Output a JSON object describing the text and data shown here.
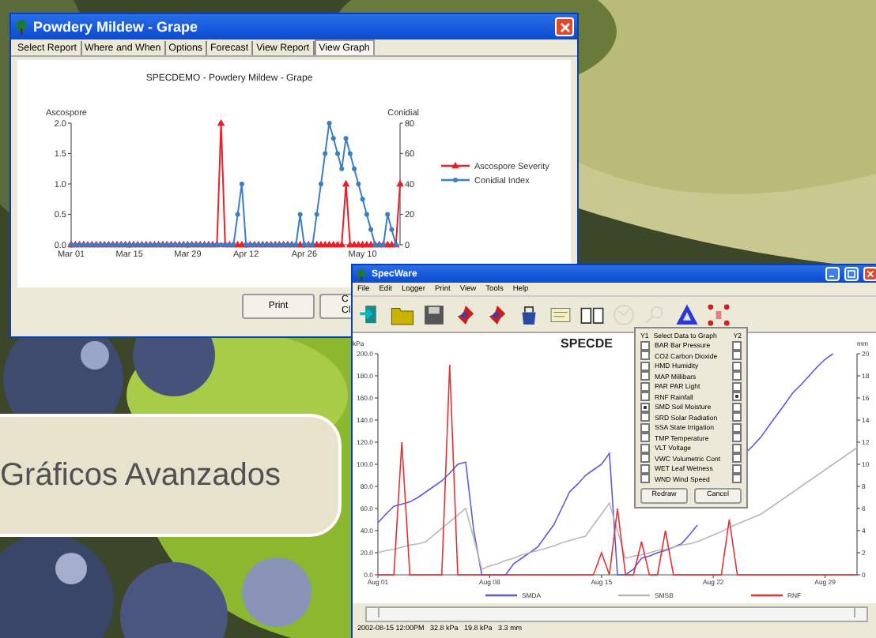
{
  "report_window": {
    "title": "Powdery Mildew - Grape",
    "tabs": [
      {
        "label": "Select Report",
        "selected": false
      },
      {
        "label": "Where and When",
        "selected": false
      },
      {
        "label": "Options",
        "selected": false
      },
      {
        "label": "Forecast",
        "selected": false
      },
      {
        "label": "View Report",
        "selected": false
      },
      {
        "label": "View Graph",
        "selected": true
      }
    ],
    "chart_data": {
      "type": "line",
      "legend": "right",
      "title": "SPECDEMO - Powdery Mildew - Grape",
      "ylabel": "Ascospore",
      "y2label": "Conidial",
      "categories": [
        "Mar 01",
        null,
        null,
        null,
        null,
        null,
        null,
        null,
        null,
        null,
        null,
        null,
        null,
        null,
        "Mar 15",
        null,
        null,
        null,
        null,
        null,
        null,
        null,
        null,
        null,
        null,
        null,
        null,
        null,
        "Mar 29",
        null,
        null,
        null,
        null,
        null,
        null,
        null,
        null,
        null,
        null,
        null,
        null,
        null,
        "Apr 12",
        null,
        null,
        null,
        null,
        null,
        null,
        null,
        null,
        null,
        null,
        null,
        null,
        null,
        "Apr 26",
        null,
        null,
        null,
        null,
        null,
        null,
        null,
        null,
        null,
        null,
        null,
        null,
        null,
        "May 10",
        null,
        null,
        null,
        null,
        null,
        null,
        null,
        null,
        null
      ],
      "ylim": [
        0,
        2
      ],
      "yticks": [
        {
          "value": 0,
          "label": "0.0"
        },
        {
          "value": 0.5,
          "label": "0.5"
        },
        {
          "value": 1,
          "label": "1.0"
        },
        {
          "value": 1.5,
          "label": "1.5"
        },
        {
          "value": 2,
          "label": "2.0"
        }
      ],
      "y2lim": [
        0,
        80
      ],
      "y2ticks": [
        0,
        20,
        40,
        60,
        80
      ],
      "series": [
        {
          "name": "Ascospore Severity",
          "color": "#e8202a",
          "marker": "triangle",
          "values": [
            0,
            0,
            0,
            0,
            0,
            0,
            0,
            0,
            0,
            0,
            0,
            0,
            0,
            0,
            0,
            0,
            0,
            0,
            0,
            0,
            0,
            0,
            0,
            0,
            0,
            0,
            0,
            0,
            0,
            0,
            0,
            0,
            0,
            0,
            0,
            0,
            2,
            0,
            0,
            0,
            0,
            0,
            0,
            0,
            0,
            0,
            0,
            0,
            0,
            0,
            0,
            0,
            0,
            0,
            0,
            0,
            0,
            0,
            0,
            0,
            0,
            0,
            0,
            0,
            0,
            0,
            1,
            0,
            0,
            0,
            0,
            0,
            0,
            0,
            0,
            0,
            0,
            0,
            0,
            1
          ]
        },
        {
          "name": "Conidial Index",
          "color": "#3a7fc4",
          "marker": "circle",
          "axis": "y2",
          "values": [
            0,
            0,
            0,
            0,
            0,
            0,
            0,
            0,
            0,
            0,
            0,
            0,
            0,
            0,
            0,
            0,
            0,
            0,
            0,
            0,
            0,
            0,
            0,
            0,
            0,
            0,
            0,
            0,
            0,
            0,
            0,
            0,
            0,
            0,
            0,
            0,
            0,
            0,
            0,
            0,
            20,
            40,
            0,
            0,
            0,
            0,
            0,
            0,
            0,
            0,
            0,
            0,
            0,
            0,
            0,
            20,
            0,
            0,
            0,
            20,
            40,
            60,
            80,
            70,
            60,
            50,
            70,
            60,
            50,
            40,
            30,
            20,
            10,
            0,
            0,
            0,
            20,
            10,
            0,
            null
          ]
        }
      ]
    },
    "buttons": [
      {
        "lines": [
          "Print"
        ]
      },
      {
        "lines": [
          "C",
          "Cl"
        ]
      }
    ]
  },
  "specware_window": {
    "title": "SpecWare",
    "menu": [
      "File",
      "Edit",
      "Logger",
      "Print",
      "View",
      "Tools",
      "Help"
    ],
    "toolbar": [
      {
        "kind": "door",
        "disabled": false
      },
      {
        "kind": "folder",
        "disabled": false
      },
      {
        "kind": "disk",
        "disabled": false
      },
      {
        "kind": "marker",
        "disabled": false
      },
      {
        "kind": "marker",
        "disabled": false
      },
      {
        "kind": "bucket",
        "disabled": false
      },
      {
        "kind": "note",
        "disabled": false
      },
      {
        "kind": "book",
        "disabled": false
      },
      {
        "kind": "dial",
        "disabled": true
      },
      {
        "kind": "magnifier",
        "disabled": true
      },
      {
        "kind": "triangle",
        "disabled": false
      },
      {
        "kind": "dots",
        "disabled": false
      }
    ],
    "chart_data": {
      "type": "line",
      "legend": "bottom",
      "title": "SPECDE",
      "ylabel": "kPa",
      "y2label": "mm",
      "categories": [
        "Aug 01",
        null,
        null,
        null,
        null,
        null,
        null,
        null,
        null,
        null,
        null,
        null,
        null,
        null,
        "Aug 08",
        null,
        null,
        null,
        null,
        null,
        null,
        null,
        null,
        null,
        null,
        null,
        null,
        null,
        "Aug 15",
        null,
        null,
        null,
        null,
        null,
        null,
        null,
        null,
        null,
        null,
        null,
        null,
        null,
        "Aug 22",
        null,
        null,
        null,
        null,
        null,
        null,
        null,
        null,
        null,
        null,
        null,
        null,
        null,
        "Aug 29",
        null,
        null,
        null,
        null
      ],
      "ylim": [
        0,
        200
      ],
      "yticks": [
        {
          "value": 0,
          "label": "0.0"
        },
        {
          "value": 20,
          "label": "20.0"
        },
        {
          "value": 40,
          "label": "40.0"
        },
        {
          "value": 60,
          "label": "60.0"
        },
        {
          "value": 80,
          "label": "80.0"
        },
        {
          "value": 100,
          "label": "100.0"
        },
        {
          "value": 120,
          "label": "120.0"
        },
        {
          "value": 140,
          "label": "140.0"
        },
        {
          "value": 160,
          "label": "160.0"
        },
        {
          "value": 180,
          "label": "180.0"
        },
        {
          "value": 200,
          "label": "200.0"
        }
      ],
      "y2lim": [
        0,
        20
      ],
      "y2ticks": [
        0,
        2,
        4,
        6,
        8,
        10,
        12,
        14,
        16,
        18,
        20
      ],
      "series": [
        {
          "name": "SMDA",
          "color": "#5a5ae0",
          "values": [
            47,
            55,
            62,
            64,
            66,
            70,
            75,
            80,
            85,
            92,
            100,
            102,
            40,
            0,
            0,
            0,
            0,
            10,
            15,
            20,
            25,
            35,
            45,
            60,
            75,
            82,
            90,
            95,
            100,
            110,
            0,
            0,
            5,
            15,
            17,
            20,
            22,
            25,
            28,
            36,
            45,
            null,
            null,
            null,
            null,
            null,
            110,
            117,
            125,
            135,
            145,
            155,
            165,
            172,
            180,
            188,
            195,
            200,
            null,
            null,
            null
          ]
        },
        {
          "name": "SMSB",
          "color": "#b8b8b8",
          "values": [
            20,
            22,
            23,
            25,
            27,
            28,
            30,
            36,
            42,
            48,
            54,
            60,
            33,
            5,
            8,
            10,
            13,
            15,
            18,
            20,
            22,
            24,
            26,
            29,
            31,
            33,
            35,
            45,
            55,
            65,
            40,
            15,
            17,
            18,
            20,
            22,
            23,
            25,
            27,
            28,
            30,
            33,
            36,
            39,
            43,
            46,
            49,
            52,
            55,
            60,
            65,
            70,
            75,
            80,
            85,
            90,
            95,
            100,
            105,
            110,
            115
          ]
        },
        {
          "name": "RNF",
          "color": "#e83030",
          "axis": "y2",
          "values": [
            0,
            0,
            0,
            12,
            0,
            0,
            0,
            0,
            0,
            19,
            0,
            0,
            0,
            0,
            0,
            0,
            0,
            0,
            0,
            0,
            0,
            0,
            0,
            0,
            0,
            0,
            0,
            0,
            2,
            0,
            6,
            0,
            0,
            3,
            0,
            0,
            4,
            0,
            0,
            0,
            0,
            0,
            0,
            0,
            5,
            0,
            0,
            0,
            0,
            0,
            0,
            0,
            0,
            0,
            0,
            0,
            0,
            0,
            0,
            0,
            0
          ]
        }
      ]
    },
    "data_selector": {
      "header": [
        "Y1",
        "Select Data to Graph",
        "Y2"
      ],
      "items": [
        {
          "label": "BAR Bar Pressure",
          "y1_checked": false,
          "y2_checked": false
        },
        {
          "label": "CO2 Carbon Dioxide",
          "y1_checked": false,
          "y2_checked": false
        },
        {
          "label": "HMD Humidity",
          "y1_checked": false,
          "y2_checked": false
        },
        {
          "label": "MAP Millibars",
          "y1_checked": false,
          "y2_checked": false
        },
        {
          "label": "PAR PAR Light",
          "y1_checked": false,
          "y2_checked": false
        },
        {
          "label": "RNF Rainfall",
          "y1_checked": false,
          "y2_checked": true
        },
        {
          "label": "SMD Soil Moisture",
          "y1_checked": true,
          "y2_checked": false
        },
        {
          "label": "SRD Solar Radiation",
          "y1_checked": false,
          "y2_checked": false
        },
        {
          "label": "SSA State Irrigation",
          "y1_checked": false,
          "y2_checked": false
        },
        {
          "label": "TMP Temperature",
          "y1_checked": false,
          "y2_checked": false
        },
        {
          "label": "VLT Voltage",
          "y1_checked": false,
          "y2_checked": false
        },
        {
          "label": "VWC Volumetric Cont",
          "y1_checked": false,
          "y2_checked": false
        },
        {
          "label": "WET Leaf Wetness",
          "y1_checked": false,
          "y2_checked": false
        },
        {
          "label": "WND Wind Speed",
          "y1_checked": false,
          "y2_checked": false
        }
      ],
      "buttons": [
        "Redraw",
        "Cancel"
      ]
    },
    "status_bar": "2002-08-15 12:00PM   32.8 kPa   19.8 kPa   3.3 mm"
  },
  "caption": "Gráficos Avanzados"
}
